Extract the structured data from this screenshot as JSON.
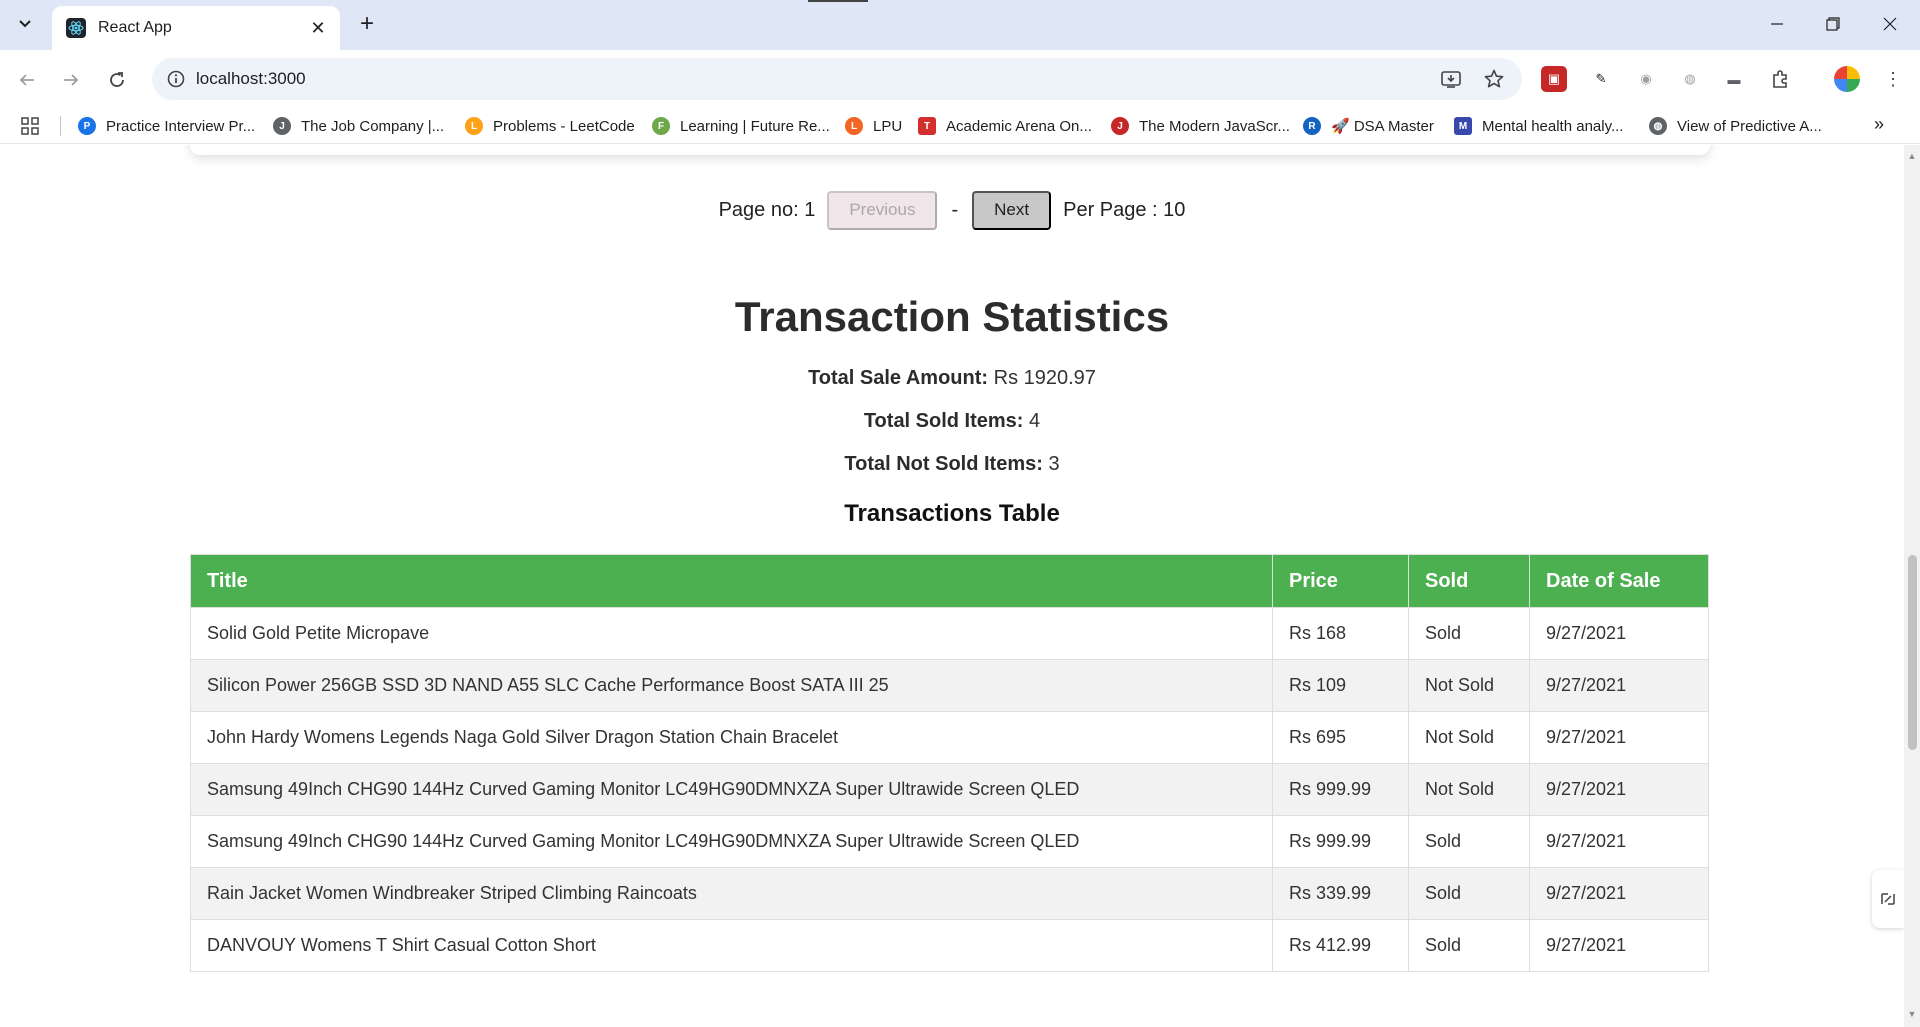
{
  "browser": {
    "tab_title": "React App",
    "url": "localhost:3000",
    "bookmarks": [
      {
        "label": "Practice Interview Pr...",
        "icon": "practice-icon",
        "color": "#1a73e8"
      },
      {
        "label": "The Job Company |...",
        "icon": "job-company-icon",
        "color": "#5f6368"
      },
      {
        "label": "Problems - LeetCode",
        "icon": "leetcode-icon",
        "color": "#ffa116"
      },
      {
        "label": "Learning | Future Re...",
        "icon": "learning-icon",
        "color": "#6ea84b"
      },
      {
        "label": "LPU",
        "icon": "lpu-icon",
        "color": "#f26522"
      },
      {
        "label": "Academic Arena On...",
        "icon": "tg-icon",
        "color": "#d32f2f"
      },
      {
        "label": "The Modern JavaScr...",
        "icon": "javascript-icon",
        "color": "#c62828"
      },
      {
        "label": "🚀 DSA Master",
        "icon": "rocket-icon",
        "color": "#1565c0"
      },
      {
        "label": "Mental health analy...",
        "icon": "mental-health-icon",
        "color": "#3949ab"
      },
      {
        "label": "View of Predictive A...",
        "icon": "globe-icon",
        "color": "#5f6368"
      }
    ]
  },
  "pagination": {
    "page_label": "Page no: 1",
    "previous_label": "Previous",
    "separator": "-",
    "next_label": "Next",
    "per_page_label": "Per Page : 10"
  },
  "stats": {
    "title": "Transaction Statistics",
    "total_sale_label": "Total Sale Amount:",
    "total_sale_value": "Rs 1920.97",
    "total_sold_label": "Total Sold Items:",
    "total_sold_value": "4",
    "total_not_sold_label": "Total Not Sold Items:",
    "total_not_sold_value": "3"
  },
  "table": {
    "heading": "Transactions Table",
    "columns": [
      "Title",
      "Price",
      "Sold",
      "Date of Sale"
    ],
    "rows": [
      {
        "title": "Solid Gold Petite Micropave",
        "price": "Rs 168",
        "sold": "Sold",
        "date": "9/27/2021"
      },
      {
        "title": "Silicon Power 256GB SSD 3D NAND A55 SLC Cache Performance Boost SATA III 25",
        "price": "Rs 109",
        "sold": "Not Sold",
        "date": "9/27/2021"
      },
      {
        "title": "John Hardy Womens Legends Naga Gold Silver Dragon Station Chain Bracelet",
        "price": "Rs 695",
        "sold": "Not Sold",
        "date": "9/27/2021"
      },
      {
        "title": "Samsung 49Inch CHG90 144Hz Curved Gaming Monitor LC49HG90DMNXZA Super Ultrawide Screen QLED",
        "price": "Rs 999.99",
        "sold": "Not Sold",
        "date": "9/27/2021"
      },
      {
        "title": "Samsung 49Inch CHG90 144Hz Curved Gaming Monitor LC49HG90DMNXZA Super Ultrawide Screen QLED",
        "price": "Rs 999.99",
        "sold": "Sold",
        "date": "9/27/2021"
      },
      {
        "title": "Rain Jacket Women Windbreaker Striped Climbing Raincoats",
        "price": "Rs 339.99",
        "sold": "Sold",
        "date": "9/27/2021"
      },
      {
        "title": "DANVOUY Womens T Shirt Casual Cotton Short",
        "price": "Rs 412.99",
        "sold": "Sold",
        "date": "9/27/2021"
      }
    ]
  },
  "colors": {
    "table_header": "#4caf50",
    "alt_row": "#f2f2f2",
    "tabstrip": "#dfe7f6"
  }
}
